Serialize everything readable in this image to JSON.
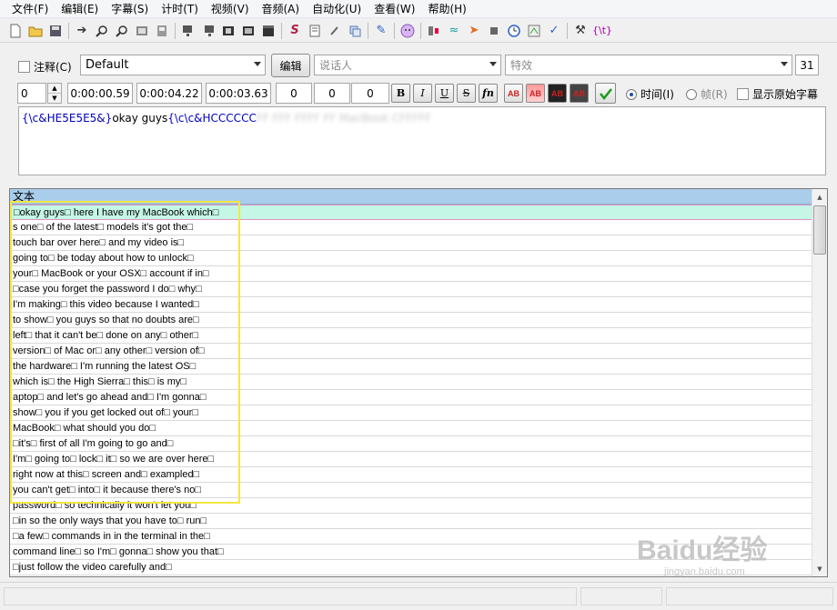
{
  "menu": [
    "文件(F)",
    "编辑(E)",
    "字幕(S)",
    "计时(T)",
    "视频(V)",
    "音频(A)",
    "自动化(U)",
    "查看(W)",
    "帮助(H)"
  ],
  "toolbar": {
    "icons": [
      "new-file-icon",
      "open-folder-icon",
      "save-icon",
      "jump-arrow-icon",
      "zoom-in-icon",
      "zoom-out-icon",
      "video-frame-icon",
      "snapshot-icon",
      "monitor-icon",
      "monitor2-icon",
      "film-icon",
      "film2-icon",
      "clapper-icon",
      "style-icon",
      "properties-icon",
      "attachments-icon",
      "fonts-icon",
      "translate-icon",
      "karaoke-icon",
      "kanji-icon",
      "timing-icon",
      "shift-icon",
      "resample-icon",
      "stop-icon",
      "clock-icon",
      "spell-check-icon",
      "check-icon",
      "tools-icon",
      "tags-icon"
    ],
    "tags_label": "{\\t}"
  },
  "edit": {
    "comment_label": "注释(C)",
    "style_value": "Default",
    "edit_button": "编辑",
    "actor_placeholder": "说话人",
    "effect_placeholder": "特效",
    "line_number": "31",
    "layer": "0",
    "start_time": "0:00:00.59",
    "end_time": "0:00:04.22",
    "duration": "0:00:03.63",
    "margin_left": "0",
    "margin_right": "0",
    "margin_vertical": "0",
    "bold": "B",
    "italic": "I",
    "underline": "U",
    "strike": "S",
    "font": "fn",
    "color1": "AB",
    "color2": "AB",
    "color3": "AB",
    "color4": "AB",
    "time_radio": "时间(I)",
    "frame_radio": "帧(R)",
    "show_original": "显示原始字幕",
    "text_part1": "{\\c&HE5E5E5&}",
    "text_part2": "okay guys",
    "text_part3": "{\\c\\c&HCCCCCC",
    "text_blur": "FF FFF FFFF FF MacBook CFFFFF"
  },
  "grid": {
    "header": "文本",
    "rows": [
      "□okay guys□ here I have my MacBook which□",
      "s one□ of the latest□ models it's got the□",
      "touch bar over here□ and my video is□",
      "going to□ be today about how to unlock□",
      "your□ MacBook or your OSX□ account if in□",
      "□case you forget the password I do□ why□",
      "I'm making□ this video because I wanted□",
      "to show□ you guys so that no doubts are□",
      "left□ that it can't be□ done on any□ other□",
      "version□ of Mac or□ any other□ version of□",
      "the hardware□ I'm running the latest OS□",
      "which is□ the High Sierra□ this□ is my□",
      "aptop□ and let's go ahead and□ I'm gonna□",
      "show□ you if you get locked out of□ your□",
      "MacBook□ what should you do□",
      "□it's□ first of all I'm going to go and□",
      "I'm□ going to□ lock□ it□ so we are over here□",
      "right now at this□ screen and□ exampled□",
      "you can't get□ into□ it because there's no□",
      "password□ so technically it won't let you□",
      "□in so the only ways that you have to□ run□",
      "□a few□ commands in in the terminal in the□",
      "command line□ so I'm□ gonna□ show you that□",
      "□just follow the video carefully and□"
    ]
  },
  "watermark": {
    "logo": "Baidu经验",
    "url": "jingyan.baidu.com"
  }
}
